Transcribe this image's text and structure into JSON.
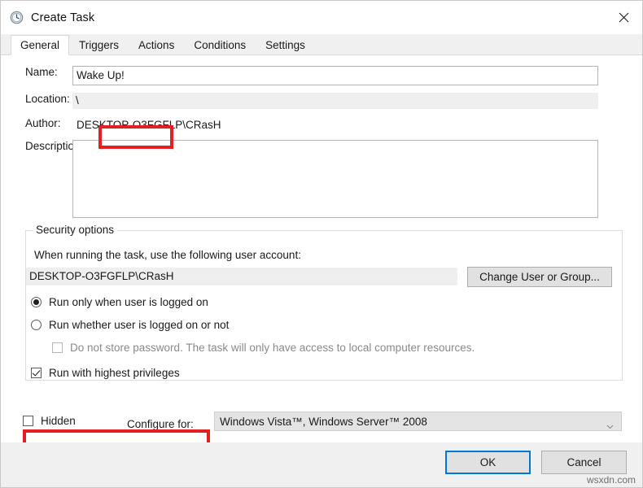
{
  "window": {
    "title": "Create Task",
    "icon": "clock-schedule-icon",
    "close_label": "×"
  },
  "tabs": [
    {
      "label": "General",
      "active": true
    },
    {
      "label": "Triggers",
      "active": false
    },
    {
      "label": "Actions",
      "active": false
    },
    {
      "label": "Conditions",
      "active": false
    },
    {
      "label": "Settings",
      "active": false
    }
  ],
  "general": {
    "name_label": "Name:",
    "name_value": "Wake Up!",
    "location_label": "Location:",
    "location_value": "\\",
    "author_label": "Author:",
    "author_value": "DESKTOP-O3FGFLP\\CRasH",
    "description_label": "Description:",
    "description_value": "",
    "description_placeholder": ""
  },
  "security": {
    "group_title": "Security options",
    "account_prompt": "When running the task, use the following user account:",
    "account_value": "DESKTOP-O3FGFLP\\CRasH",
    "change_user_button": "Change User or Group...",
    "run_logged_on": {
      "label": "Run only when user is logged on",
      "checked": true
    },
    "run_whether": {
      "label": "Run whether user is logged on or not",
      "checked": false
    },
    "do_not_store_password": {
      "label": "Do not store password.  The task will only have access to local computer resources.",
      "checked": false,
      "disabled": true
    },
    "run_highest_privileges": {
      "label": "Run with highest privileges",
      "checked": true
    }
  },
  "bottom": {
    "hidden_label": "Hidden",
    "hidden_checked": false,
    "configure_for_label": "Configure for:",
    "configure_for_value": "Windows Vista™, Windows Server™ 2008",
    "configure_for_arrow": "chevron-down-icon"
  },
  "footer": {
    "ok_label": "OK",
    "cancel_label": "Cancel",
    "watermark": "wsxdn.com"
  },
  "annotations": {
    "highlight_color": "#e3201f",
    "highlighted_name_field": "Wake Up!",
    "highlighted_checkbox": "Run with highest privileges"
  }
}
